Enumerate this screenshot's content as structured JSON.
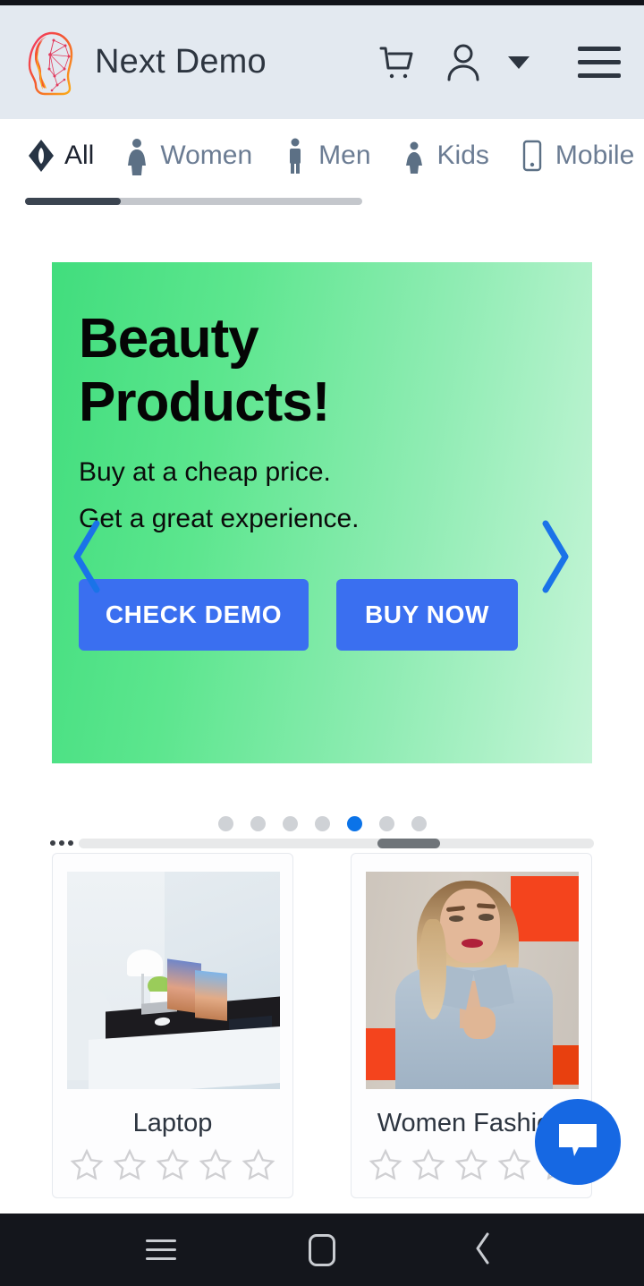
{
  "header": {
    "brand_title": "Next Demo",
    "logo_icon": "head-network-logo",
    "cart_icon": "shopping-cart-icon",
    "account_icon": "user-account-icon",
    "caret_icon": "chevron-down-icon",
    "menu_icon": "hamburger-menu-icon",
    "background_color": "#e3e9f0"
  },
  "categories": {
    "items": [
      {
        "label": "All",
        "icon": "diamond-icon",
        "active": true
      },
      {
        "label": "Women",
        "icon": "woman-figure-icon",
        "active": false
      },
      {
        "label": "Men",
        "icon": "man-figure-icon",
        "active": false
      },
      {
        "label": "Kids",
        "icon": "child-figure-icon",
        "active": false
      },
      {
        "label": "Mobile",
        "icon": "smartphone-icon",
        "active": false
      }
    ],
    "scrollbar_position_percent": 0
  },
  "hero": {
    "title_line1": "Beauty",
    "title_line2": "Products!",
    "subtitle_line1": "Buy at a cheap price.",
    "subtitle_line2": "Get a great experience.",
    "primary_button": "CHECK DEMO",
    "secondary_button": "BUY NOW",
    "prev_icon": "chevron-left-icon",
    "next_icon": "chevron-right-icon",
    "gradient_from": "#41dd7d",
    "gradient_to": "#c6f5d8",
    "button_color": "#3a6ff0",
    "arrow_color": "#1a73e8"
  },
  "carousel": {
    "total_dots": 7,
    "active_index": 4,
    "active_color": "#0b73e8",
    "inactive_color": "#cfd2d6"
  },
  "product_scrollbar": {
    "overflow_icon": "ellipsis-icon",
    "thumb_position_percent": 58
  },
  "products": [
    {
      "title": "Laptop",
      "rating": 0,
      "max_rating": 5,
      "image": "laptop-desk-photo"
    },
    {
      "title": "Women Fashion",
      "rating": 0,
      "max_rating": 5,
      "image": "woman-denim-photo"
    }
  ],
  "chat": {
    "icon": "chat-bubble-icon",
    "color": "#1668e3"
  },
  "navbar": {
    "recents_icon": "recents-icon",
    "home_icon": "home-icon",
    "back_icon": "back-chevron-icon",
    "background_color": "#14161c"
  }
}
